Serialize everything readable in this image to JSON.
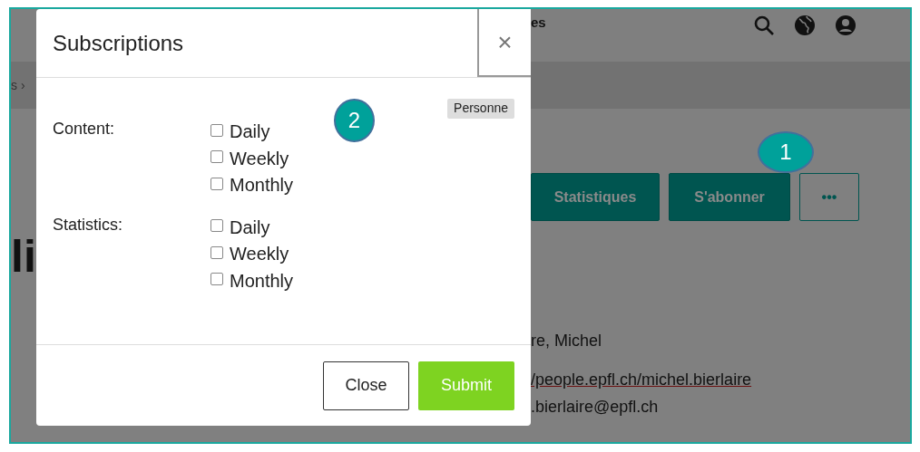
{
  "page": {
    "nav_text": "es",
    "breadcrumb": "s ›",
    "heading": "li",
    "actions": [
      {
        "label": "Statistiques",
        "kind": "filled"
      },
      {
        "label": "S'abonner",
        "kind": "filled"
      },
      {
        "label": "•••",
        "kind": "outline"
      }
    ],
    "details": [
      {
        "text": "re, Michel",
        "kind": "text"
      },
      {
        "text": "/people.epfl.ch/michel.bierlaire",
        "kind": "link"
      },
      {
        "text": ".bierlaire@epfl.ch",
        "kind": "text"
      }
    ]
  },
  "dialog": {
    "title": "Subscriptions",
    "close": "×",
    "badge": "Personne",
    "groups": [
      {
        "label": "Content:",
        "options": [
          {
            "label": "Daily",
            "checked": false
          },
          {
            "label": "Weekly",
            "checked": false
          },
          {
            "label": "Monthly",
            "checked": false
          }
        ]
      },
      {
        "label": "Statistics:",
        "options": [
          {
            "label": "Daily",
            "checked": false
          },
          {
            "label": "Weekly",
            "checked": false
          },
          {
            "label": "Monthly",
            "checked": false
          }
        ]
      }
    ],
    "buttons": [
      {
        "label": "Close",
        "kind": "secondary"
      },
      {
        "label": "Submit",
        "kind": "primary"
      }
    ]
  },
  "callouts": [
    {
      "label": "1"
    },
    {
      "label": "2"
    }
  ]
}
